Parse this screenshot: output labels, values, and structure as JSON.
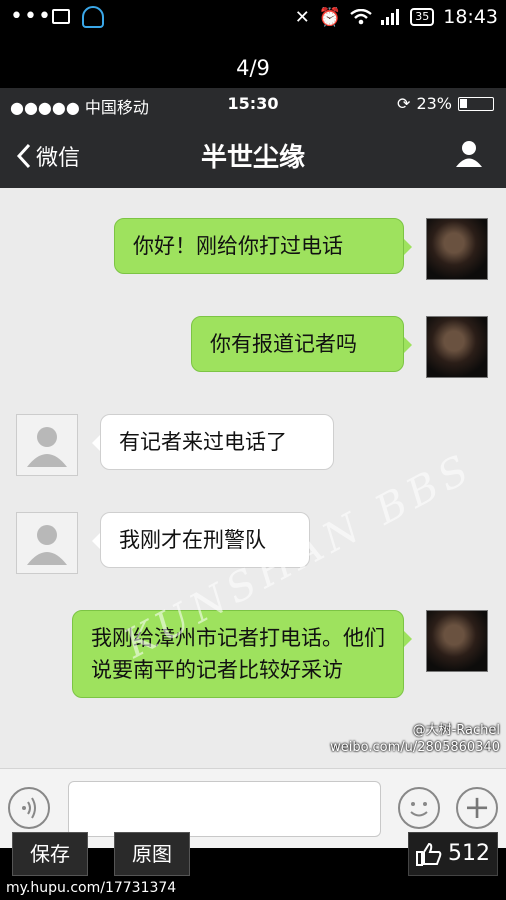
{
  "android_status": {
    "time": "18:43",
    "battery": "35"
  },
  "gallery": {
    "counter": "4/9"
  },
  "ios_status": {
    "carrier": "●●●●● 中国移动",
    "time": "15:30",
    "battery": "23%"
  },
  "navbar": {
    "back_label": "微信",
    "title": "半世尘缘"
  },
  "messages": [
    {
      "side": "out",
      "text": "你好！刚给你打过电话"
    },
    {
      "side": "out",
      "text": "你有报道记者吗"
    },
    {
      "side": "in",
      "text": "有记者来过电话了"
    },
    {
      "side": "in",
      "text": "我刚才在刑警队"
    },
    {
      "side": "out",
      "text": "我刚给漳州市记者打电话。他们说要南平的记者比较好采访"
    }
  ],
  "watermark": "KUNSHAN BBS",
  "weibo_watermark": {
    "line1": "@大树-Rachel",
    "line2": "weibo.com/u/2805860340"
  },
  "toolbar": {
    "save_label": "保存",
    "original_label": "原图",
    "likes": "512"
  },
  "footer": "my.hupu.com/17731374"
}
